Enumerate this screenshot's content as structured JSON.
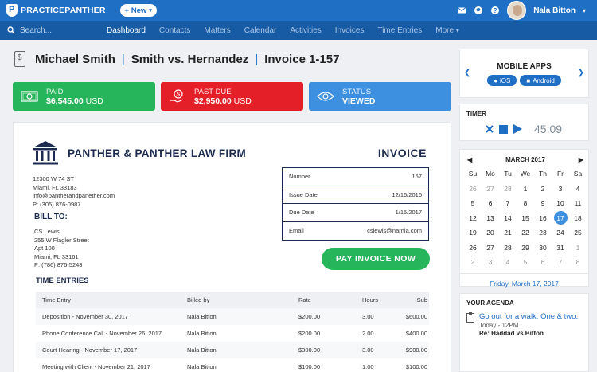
{
  "app": {
    "brand": "PRACTICEPANTHER",
    "new_label": "+ New"
  },
  "user": {
    "name": "Nala Bitton"
  },
  "nav": {
    "search_placeholder": "Search...",
    "items": [
      "Dashboard",
      "Contacts",
      "Matters",
      "Calendar",
      "Activities",
      "Invoices",
      "Time Entries",
      "More"
    ],
    "active": "Dashboard"
  },
  "header": {
    "contact": "Michael Smith",
    "matter": "Smith vs. Hernandez",
    "invoice": "Invoice 1-157"
  },
  "cards": {
    "paid": {
      "label": "PAID",
      "amount": "$6,545.00",
      "currency": "USD"
    },
    "past_due": {
      "label": "PAST DUE",
      "amount": "$2,950.00",
      "currency": "USD"
    },
    "status": {
      "label": "STATUS",
      "value": "VIEWED"
    }
  },
  "invoice": {
    "firm_name": "PANTHER & PANTHER LAW FIRM",
    "title": "INVOICE",
    "address": [
      "12300 W 74 ST",
      "Miami, FL 33183",
      "info@pantherandpanether.com",
      "P: (305) 876-0987"
    ],
    "bill_to_label": "BILL TO:",
    "bill_to": [
      "CS Lewis",
      "255 W Flagler Street",
      "Apt 100",
      "Miami, FL 33161",
      "P: (786) 876-5243"
    ],
    "meta": [
      {
        "label": "Number",
        "value": "157"
      },
      {
        "label": "Issue Date",
        "value": "12/16/2016"
      },
      {
        "label": "Due Date",
        "value": "1/15/2017"
      },
      {
        "label": "Email",
        "value": "cslewis@narnia.com"
      }
    ],
    "pay_label": "PAY INVOICE NOW",
    "time_entries_label": "TIME ENTRIES",
    "columns": [
      "Time Entry",
      "Billed by",
      "Rate",
      "Hours",
      "Sub"
    ],
    "rows": [
      [
        "Deposition - November 30, 2017",
        "Nala Bitton",
        "$200.00",
        "3.00",
        "$600.00"
      ],
      [
        "Phone Conference Call - November 26, 2017",
        "Nala Bitton",
        "$200.00",
        "2.00",
        "$400.00"
      ],
      [
        "Court Hearing - November 17, 2017",
        "Nala Bitton",
        "$300.00",
        "3.00",
        "$900.00"
      ],
      [
        "Meeting with Client - November 21, 2017",
        "Nala Bitton",
        "$100.00",
        "1.00",
        "$100.00"
      ]
    ]
  },
  "mobile_apps": {
    "title": "MOBILE APPS",
    "ios": "iOS",
    "android": "Android"
  },
  "timer": {
    "title": "TIMER",
    "time": "45:09"
  },
  "calendar": {
    "month": "MARCH 2017",
    "weekdays": [
      "Su",
      "Mo",
      "Tu",
      "We",
      "Th",
      "Fr",
      "Sa"
    ],
    "days": [
      [
        "26",
        "27",
        "28",
        "1",
        "2",
        "3",
        "4"
      ],
      [
        "5",
        "6",
        "7",
        "8",
        "9",
        "10",
        "11"
      ],
      [
        "12",
        "13",
        "14",
        "15",
        "16",
        "17",
        "18"
      ],
      [
        "19",
        "20",
        "21",
        "22",
        "23",
        "24",
        "25"
      ],
      [
        "26",
        "27",
        "28",
        "29",
        "30",
        "31",
        "1"
      ],
      [
        "2",
        "3",
        "4",
        "5",
        "6",
        "7",
        "8"
      ]
    ],
    "today": "17",
    "selected_date": "Friday, March 17, 2017"
  },
  "agenda": {
    "title": "YOUR AGENDA",
    "event_title": "Go out for a walk. One & two.",
    "event_time": "Today - 12PM",
    "event_matter": "Re: Haddad vs.Bitton"
  },
  "colors": {
    "brand_blue": "#1f6fc5",
    "nav_blue": "#175ba5",
    "paid_green": "#27b55b",
    "due_red": "#e51f27",
    "status_blue": "#3d8fe0",
    "firm_navy": "#1c2b4f"
  }
}
